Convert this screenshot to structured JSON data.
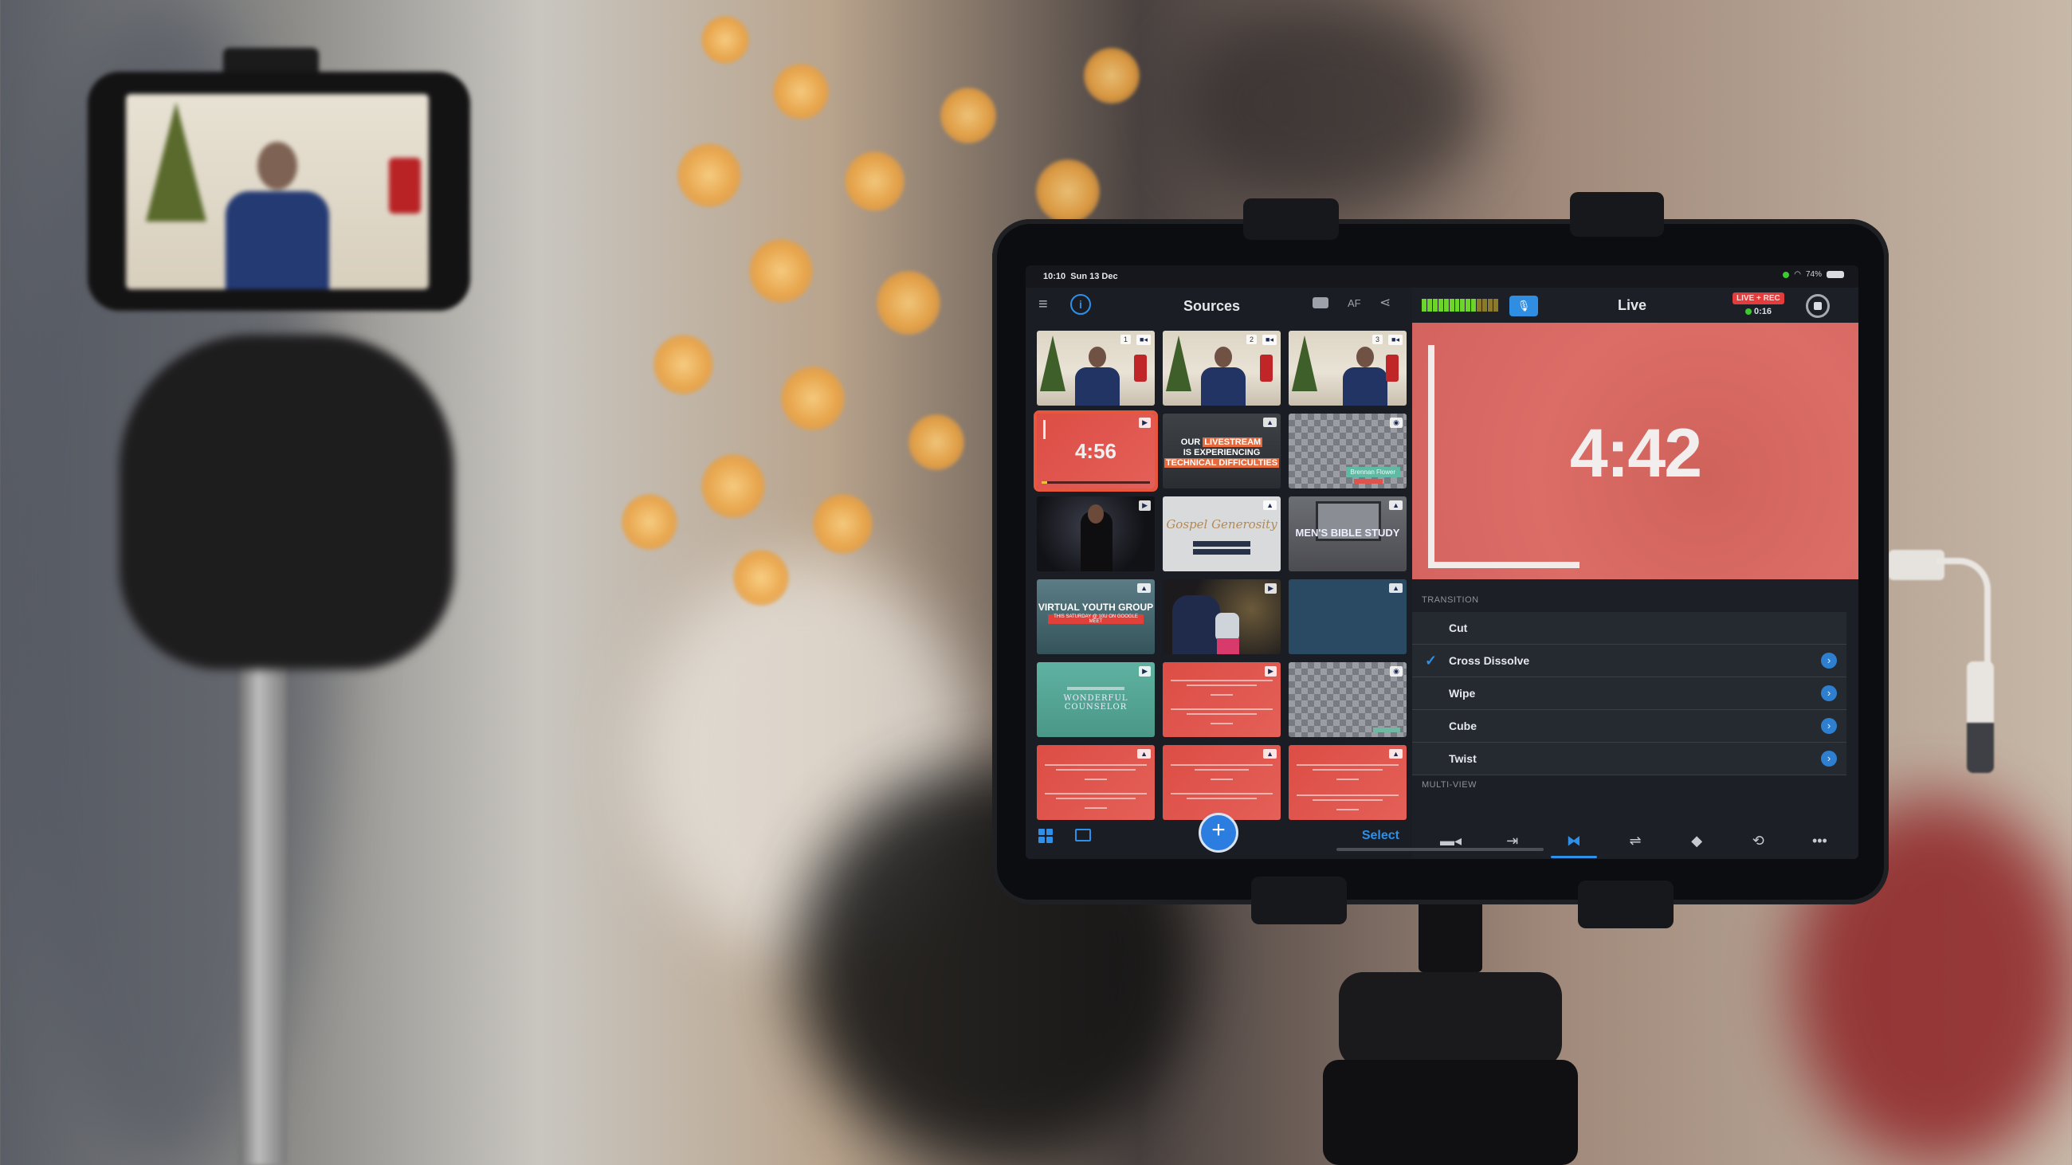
{
  "scene": {
    "description": "Photo of a live-streaming setup: a phone on a tripod (left) showing a camera feed, and a tablet on a tripod (right) running a live video switching app"
  },
  "phone_screen": {
    "content": "camera feed of a man in an argyle sweater in front of a Christmas mantel"
  },
  "tablet": {
    "status_bar": {
      "time": "10:10",
      "date": "Sun 13 Dec",
      "battery": "74%"
    },
    "sources_panel": {
      "title": "Sources",
      "icons": {
        "menu": "menu-icon",
        "info": "info-icon",
        "snapshot": "camera-icon",
        "autofocus_label": "AF",
        "share": "share-icon"
      },
      "tiles": [
        {
          "kind": "camera",
          "number": "1",
          "badge": "video-camera-icon",
          "label": "Camera 1"
        },
        {
          "kind": "camera",
          "number": "2",
          "badge": "video-camera-icon",
          "label": "Camera 2"
        },
        {
          "kind": "camera",
          "number": "3",
          "badge": "video-camera-icon",
          "label": "Camera 3"
        },
        {
          "kind": "timer",
          "text": "4:56",
          "badge": "play-icon",
          "selected": true,
          "progress": 0.05
        },
        {
          "kind": "graphic",
          "badge": "image-icon",
          "lines": [
            "OUR",
            "LIVESTREAM",
            "IS EXPERIENCING",
            "TECHNICAL DIFFICULTIES"
          ]
        },
        {
          "kind": "overlay",
          "badge": "eye-icon",
          "lower_third": "Brennan Flower"
        },
        {
          "kind": "video",
          "badge": "play-icon",
          "label": "Stage performance"
        },
        {
          "kind": "graphic",
          "badge": "image-icon",
          "title": "Gospel Generosity"
        },
        {
          "kind": "graphic",
          "badge": "image-icon",
          "title": "MEN'S BIBLE STUDY"
        },
        {
          "kind": "graphic",
          "badge": "image-icon",
          "title": "VIRTUAL YOUTH GROUP",
          "subtitle": "THIS SATURDAY @ 10U ON GOOGLE MEET"
        },
        {
          "kind": "video",
          "badge": "play-icon",
          "label": "Family by Christmas tree"
        },
        {
          "kind": "graphic",
          "badge": "image-icon",
          "label": "Solid navy"
        },
        {
          "kind": "video",
          "badge": "play-icon",
          "title": "WONDERFUL COUNSELOR"
        },
        {
          "kind": "verse",
          "badge": "play-icon"
        },
        {
          "kind": "overlay",
          "badge": "eye-icon"
        },
        {
          "kind": "verse",
          "badge": "image-icon"
        },
        {
          "kind": "verse",
          "badge": "image-icon"
        },
        {
          "kind": "verse",
          "badge": "image-icon"
        }
      ],
      "bottom": {
        "grid_view": "grid-icon",
        "layout_view": "layout-icon",
        "add_label": "+",
        "select_label": "Select"
      }
    },
    "live_panel": {
      "title": "Live",
      "audio_meter_level": 0.7,
      "mic_icon": "microphone-icon",
      "rec_badge": "LIVE + REC",
      "rec_time": "0:16",
      "program_output": "4:42",
      "transition": {
        "label": "TRANSITION",
        "options": [
          {
            "label": "Cut",
            "selected": false,
            "has_info": false
          },
          {
            "label": "Cross Dissolve",
            "selected": true,
            "has_info": true
          },
          {
            "label": "Wipe",
            "selected": false,
            "has_info": true
          },
          {
            "label": "Cube",
            "selected": false,
            "has_info": true
          },
          {
            "label": "Twist",
            "selected": false,
            "has_info": true
          }
        ]
      },
      "multi_view_label": "MULTI-VIEW",
      "toolbar": [
        {
          "name": "camera",
          "glyph": "▬◂",
          "active": false
        },
        {
          "name": "output",
          "glyph": "⇥",
          "active": false
        },
        {
          "name": "transition",
          "glyph": "⧓",
          "active": true
        },
        {
          "name": "adjust",
          "glyph": "⇌",
          "active": false
        },
        {
          "name": "audio",
          "glyph": "◆",
          "active": false
        },
        {
          "name": "loop",
          "glyph": "⟲",
          "active": false
        },
        {
          "name": "more",
          "glyph": "•••",
          "active": false
        }
      ]
    }
  },
  "colors": {
    "accent": "#2e90e8",
    "live_red": "#e33c3c",
    "program_bg": "#d8665f",
    "selected_outline": "#e8563d"
  }
}
